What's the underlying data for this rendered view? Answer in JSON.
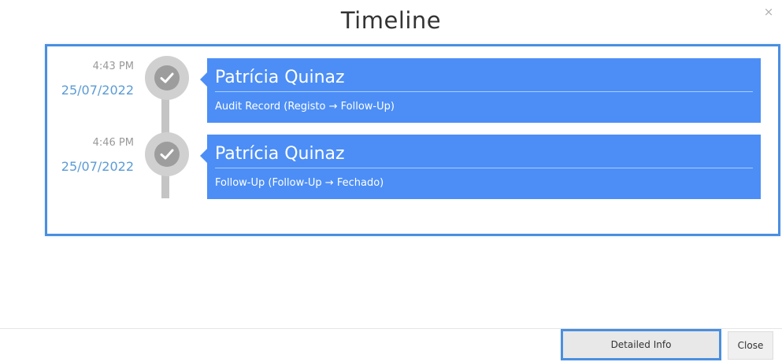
{
  "dialog": {
    "title": "Timeline",
    "close_icon": "×",
    "close_icon_name": "close-icon"
  },
  "timeline": {
    "entries": [
      {
        "time": "4:43 PM",
        "date": "25/07/2022",
        "user": "Patrícia Quinaz",
        "description": "Audit Record (Registo → Follow-Up)",
        "status_icon": "checkmark-icon"
      },
      {
        "time": "4:46 PM",
        "date": "25/07/2022",
        "user": "Patrícia Quinaz",
        "description": "Follow-Up (Follow-Up → Fechado)",
        "status_icon": "checkmark-icon"
      }
    ]
  },
  "footer": {
    "detailed_info_label": "Detailed Info",
    "close_label": "Close"
  },
  "colors": {
    "card_background": "#4c8ef6",
    "focus_outline": "#4a8fe0",
    "date_text": "#5b9bd5",
    "node_outer": "#d0d0d0",
    "node_inner": "#9d9d9d"
  }
}
